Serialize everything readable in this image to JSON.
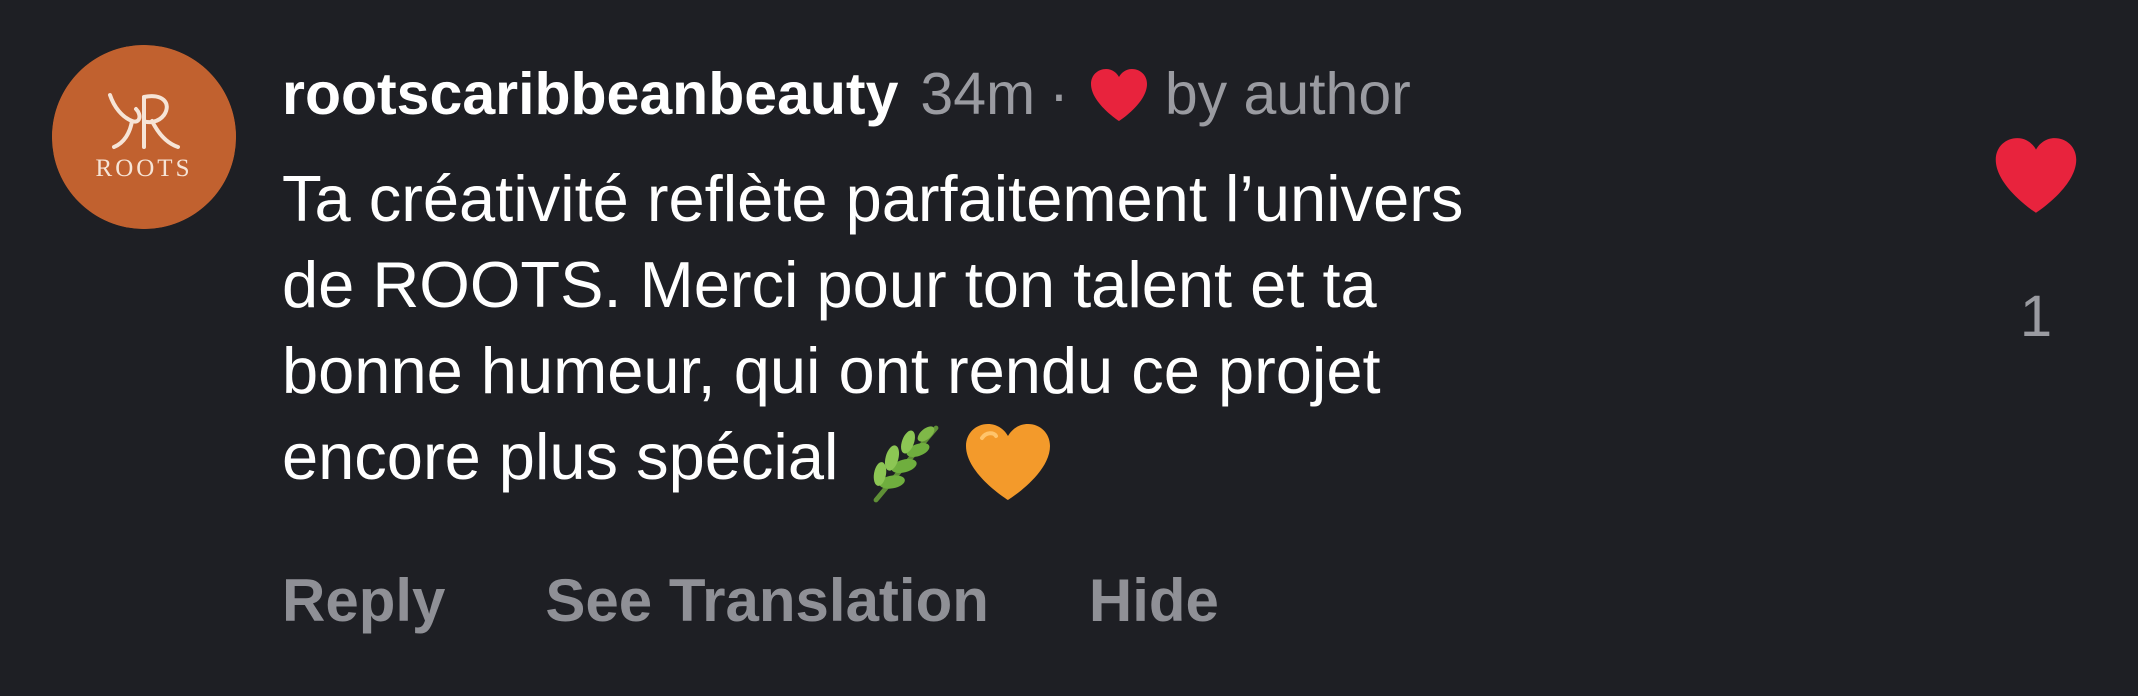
{
  "comment": {
    "avatar": {
      "logo_monogram": "YR",
      "logo_label": "ROOTS",
      "background": "#c1612f"
    },
    "username": "rootscaribbeanbeauty",
    "timestamp": "34m",
    "separator": "·",
    "author_liked_icon": "red-heart-icon",
    "author_liked_label": "by author",
    "text_lines": [
      "Ta créativité reflète parfaitement l’univers",
      "de ROOTS. Merci pour ton talent et ta",
      "bonne humeur, qui ont rendu ce projet",
      "encore plus spécial"
    ],
    "emojis": [
      "herb-emoji",
      "orange-heart-emoji"
    ],
    "actions": {
      "reply": "Reply",
      "see_translation": "See Translation",
      "hide": "Hide"
    },
    "like": {
      "icon": "heart-icon",
      "liked": true,
      "color": "#e8233d",
      "count": "1"
    }
  }
}
